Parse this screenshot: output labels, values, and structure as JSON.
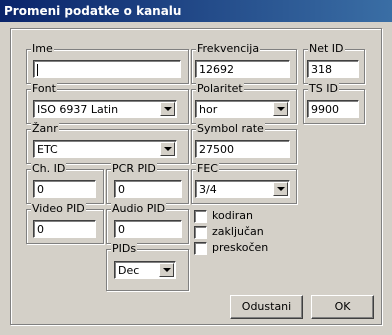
{
  "window": {
    "title": "Promeni podatke o kanalu"
  },
  "fields": {
    "ime": {
      "label": "Ime",
      "value": ""
    },
    "frekvencija": {
      "label": "Frekvencija",
      "value": "12692"
    },
    "net_id": {
      "label": "Net ID",
      "value": "318"
    },
    "font": {
      "label": "Font",
      "value": "ISO 6937 Latin"
    },
    "polaritet": {
      "label": "Polaritet",
      "value": "hor"
    },
    "ts_id": {
      "label": "TS ID",
      "value": "9900"
    },
    "zanr": {
      "label": "Žanr",
      "value": "ETC"
    },
    "symbol_rate": {
      "label": "Symbol rate",
      "value": "27500"
    },
    "ch_id": {
      "label": "Ch. ID",
      "value": "0"
    },
    "pcr_pid": {
      "label": "PCR PID",
      "value": "0"
    },
    "fec": {
      "label": "FEC",
      "value": "3/4"
    },
    "video_pid": {
      "label": "Video PID",
      "value": "0"
    },
    "audio_pid": {
      "label": "Audio PID",
      "value": "0"
    },
    "pids": {
      "label": "PIDs",
      "value": "Dec"
    }
  },
  "checkboxes": {
    "kodiran": {
      "label": "kodiran",
      "checked": false
    },
    "zakljucan": {
      "label": "zaključan",
      "checked": false
    },
    "preskocen": {
      "label": "preskočen",
      "checked": false
    }
  },
  "buttons": {
    "cancel": "Odustani",
    "ok": "OK"
  }
}
